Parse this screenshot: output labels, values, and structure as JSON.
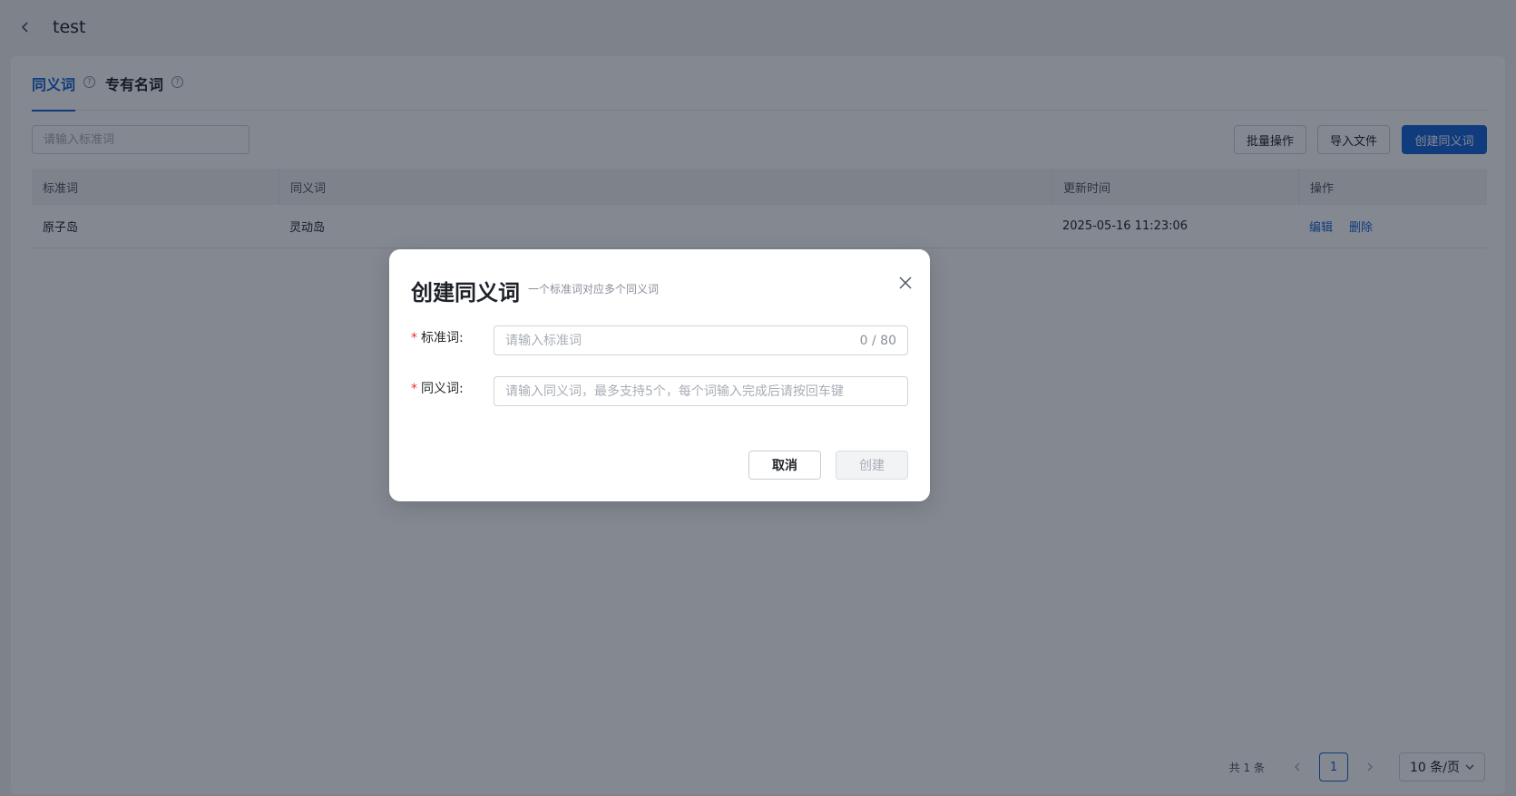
{
  "header": {
    "title": "test"
  },
  "tabs": [
    {
      "label": "同义词",
      "active": true
    },
    {
      "label": "专有名词",
      "active": false
    }
  ],
  "toolbar": {
    "search_placeholder": "请输入标准词",
    "batch_label": "批量操作",
    "import_label": "导入文件",
    "create_label": "创建同义词"
  },
  "table": {
    "columns": [
      "标准词",
      "同义词",
      "更新时间",
      "操作"
    ],
    "rows": [
      {
        "standard": "原子岛",
        "synonyms": "灵动岛",
        "updated": "2025-05-16 11:23:06",
        "edit": "编辑",
        "delete": "删除"
      }
    ]
  },
  "pagination": {
    "total": "共 1 条",
    "current_page": "1",
    "page_size": "10 条/页"
  },
  "modal": {
    "title": "创建同义词",
    "subtitle": "一个标准词对应多个同义词",
    "required_mark": "*",
    "standard_label": "标准词:",
    "standard_placeholder": "请输入标准词",
    "standard_counter": "0 / 80",
    "synonym_label": "同义词:",
    "synonym_placeholder": "请输入同义词，最多支持5个，每个词输入完成后请按回车键",
    "cancel_label": "取消",
    "create_label": "创建"
  },
  "colors": {
    "primary": "#1664d9",
    "required": "#e5302d",
    "mask": "rgba(10,18,33,0.5)"
  },
  "icons": [
    "chevron-left-icon",
    "help-circle-icon",
    "close-icon",
    "chevron-down-icon",
    "chevron-right-icon"
  ]
}
